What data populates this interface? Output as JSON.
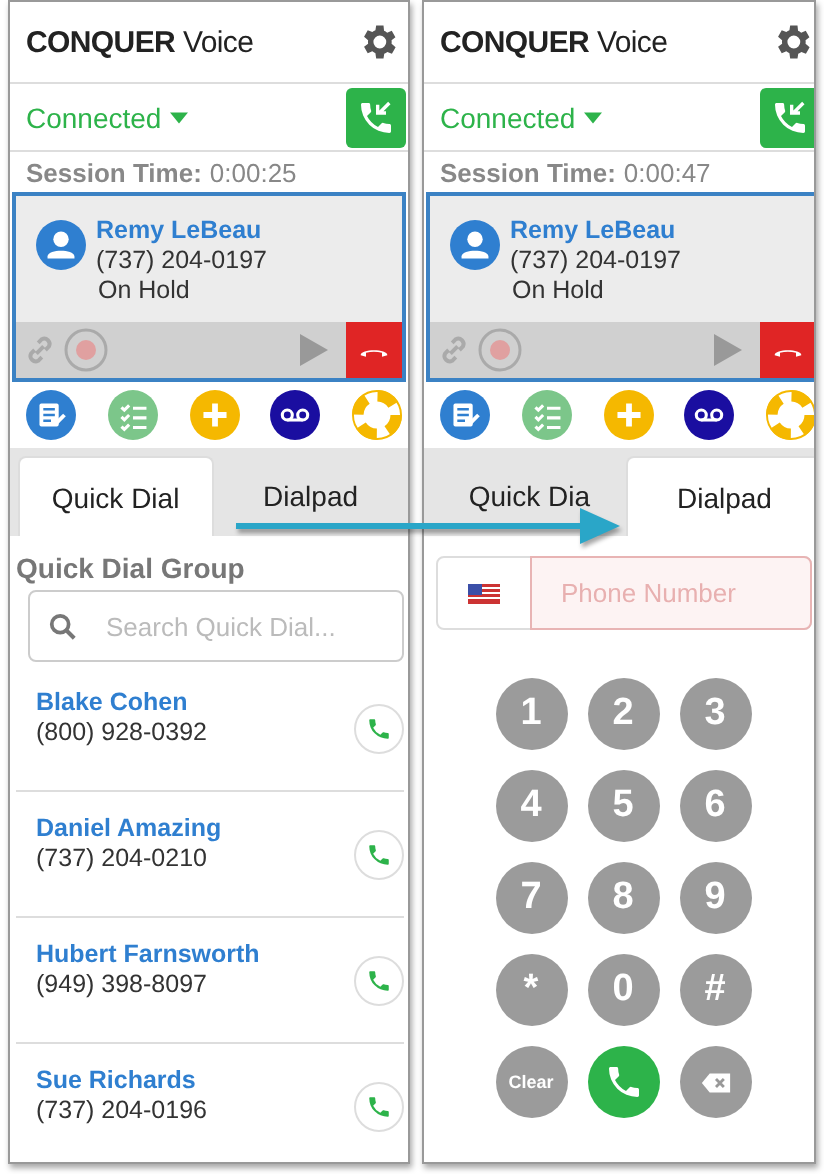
{
  "panels": [
    {
      "brand": {
        "bold": "CONQUER",
        "light": "Voice"
      },
      "status": "Connected",
      "session_label": "Session Time:",
      "session_time": "0:00:25",
      "call": {
        "name": "Remy LeBeau",
        "number": "(737) 204-0197",
        "state": "On Hold"
      },
      "tabs": [
        {
          "label": "Quick Dial",
          "selected": true
        },
        {
          "label": "Dialpad",
          "selected": false
        }
      ],
      "view": {
        "kind": "quick_dial",
        "group_title": "Quick Dial Group",
        "search_placeholder": "Search Quick Dial...",
        "contacts": [
          {
            "name": "Blake Cohen",
            "number": "(800) 928-0392"
          },
          {
            "name": "Daniel Amazing",
            "number": "(737) 204-0210"
          },
          {
            "name": "Hubert Farnsworth",
            "number": "(949) 398-8097"
          },
          {
            "name": "Sue Richards",
            "number": "(737) 204-0196"
          }
        ]
      }
    },
    {
      "brand": {
        "bold": "CONQUER",
        "light": "Voice"
      },
      "status": "Connected",
      "session_label": "Session Time:",
      "session_time": "0:00:47",
      "call": {
        "name": "Remy LeBeau",
        "number": "(737) 204-0197",
        "state": "On Hold"
      },
      "tabs": [
        {
          "label": "Quick Dia",
          "selected": false
        },
        {
          "label": "Dialpad",
          "selected": true
        }
      ],
      "view": {
        "kind": "dialpad",
        "placeholder": "Phone Number",
        "keys": [
          {
            "kind": "digit",
            "label": "1"
          },
          {
            "kind": "digit",
            "label": "2"
          },
          {
            "kind": "digit",
            "label": "3"
          },
          {
            "kind": "digit",
            "label": "4"
          },
          {
            "kind": "digit",
            "label": "5"
          },
          {
            "kind": "digit",
            "label": "6"
          },
          {
            "kind": "digit",
            "label": "7"
          },
          {
            "kind": "digit",
            "label": "8"
          },
          {
            "kind": "digit",
            "label": "9"
          },
          {
            "kind": "digit",
            "label": "*"
          },
          {
            "kind": "digit",
            "label": "0"
          },
          {
            "kind": "digit",
            "label": "#"
          },
          {
            "kind": "clear",
            "label": "Clear"
          },
          {
            "kind": "call"
          },
          {
            "kind": "backspace"
          }
        ]
      }
    }
  ]
}
